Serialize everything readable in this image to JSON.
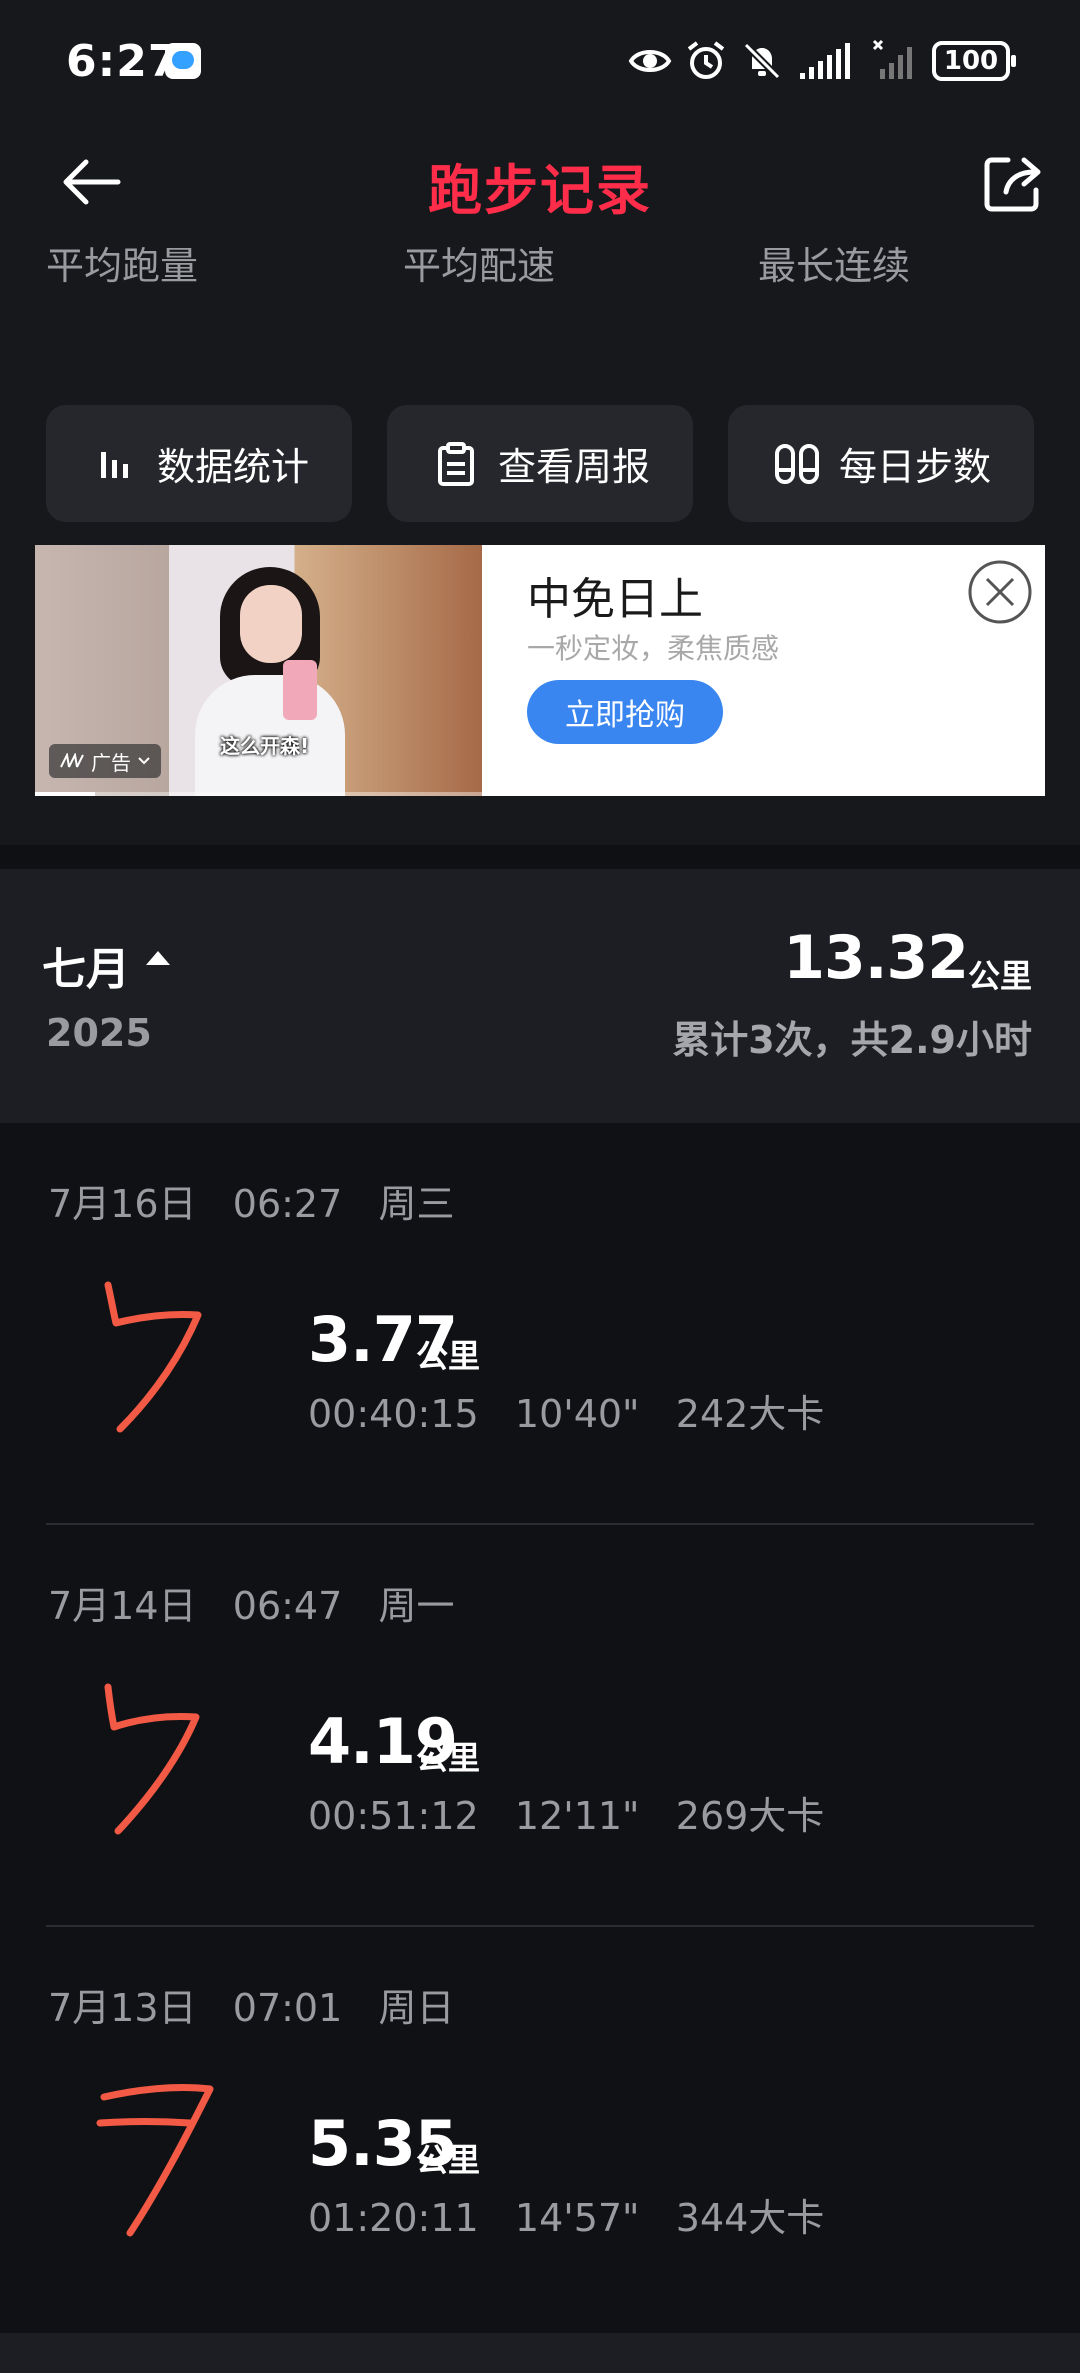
{
  "status_bar": {
    "time": "6:27",
    "battery": "100"
  },
  "header": {
    "title": "跑步记录"
  },
  "summary": {
    "labels": [
      "平均跑量",
      "平均配速",
      "最长连续"
    ]
  },
  "quick_actions": [
    {
      "label": "数据统计",
      "icon": "bar-chart-icon"
    },
    {
      "label": "查看周报",
      "icon": "clipboard-icon"
    },
    {
      "label": "每日步数",
      "icon": "footprints-icon"
    }
  ],
  "ad": {
    "title": "中免日上",
    "subtitle": "一秒定妆，柔焦质感",
    "cta": "立即抢购",
    "badge": "广告",
    "caption": "这么开森!"
  },
  "month": {
    "name": "七月",
    "year": "2025",
    "total_distance": "13.32",
    "unit": "公里",
    "description": "累计3次，共2.9小时"
  },
  "records": [
    {
      "date": "7月16日   06:27   周三",
      "distance": "3.77",
      "unit": "公里",
      "stats": "00:40:15   10'40\"   242大卡"
    },
    {
      "date": "7月14日   06:47   周一",
      "distance": "4.19",
      "unit": "公里",
      "stats": "00:51:12   12'11\"   269大卡"
    },
    {
      "date": "7月13日   07:01   周日",
      "distance": "5.35",
      "unit": "公里",
      "stats": "01:20:11   14'57\"   344大卡"
    }
  ],
  "colors": {
    "accent": "#ff2d4a",
    "background": "#101115",
    "panel": "#1d1e23",
    "mark": "#f25a45",
    "cta": "#3a86f0"
  }
}
